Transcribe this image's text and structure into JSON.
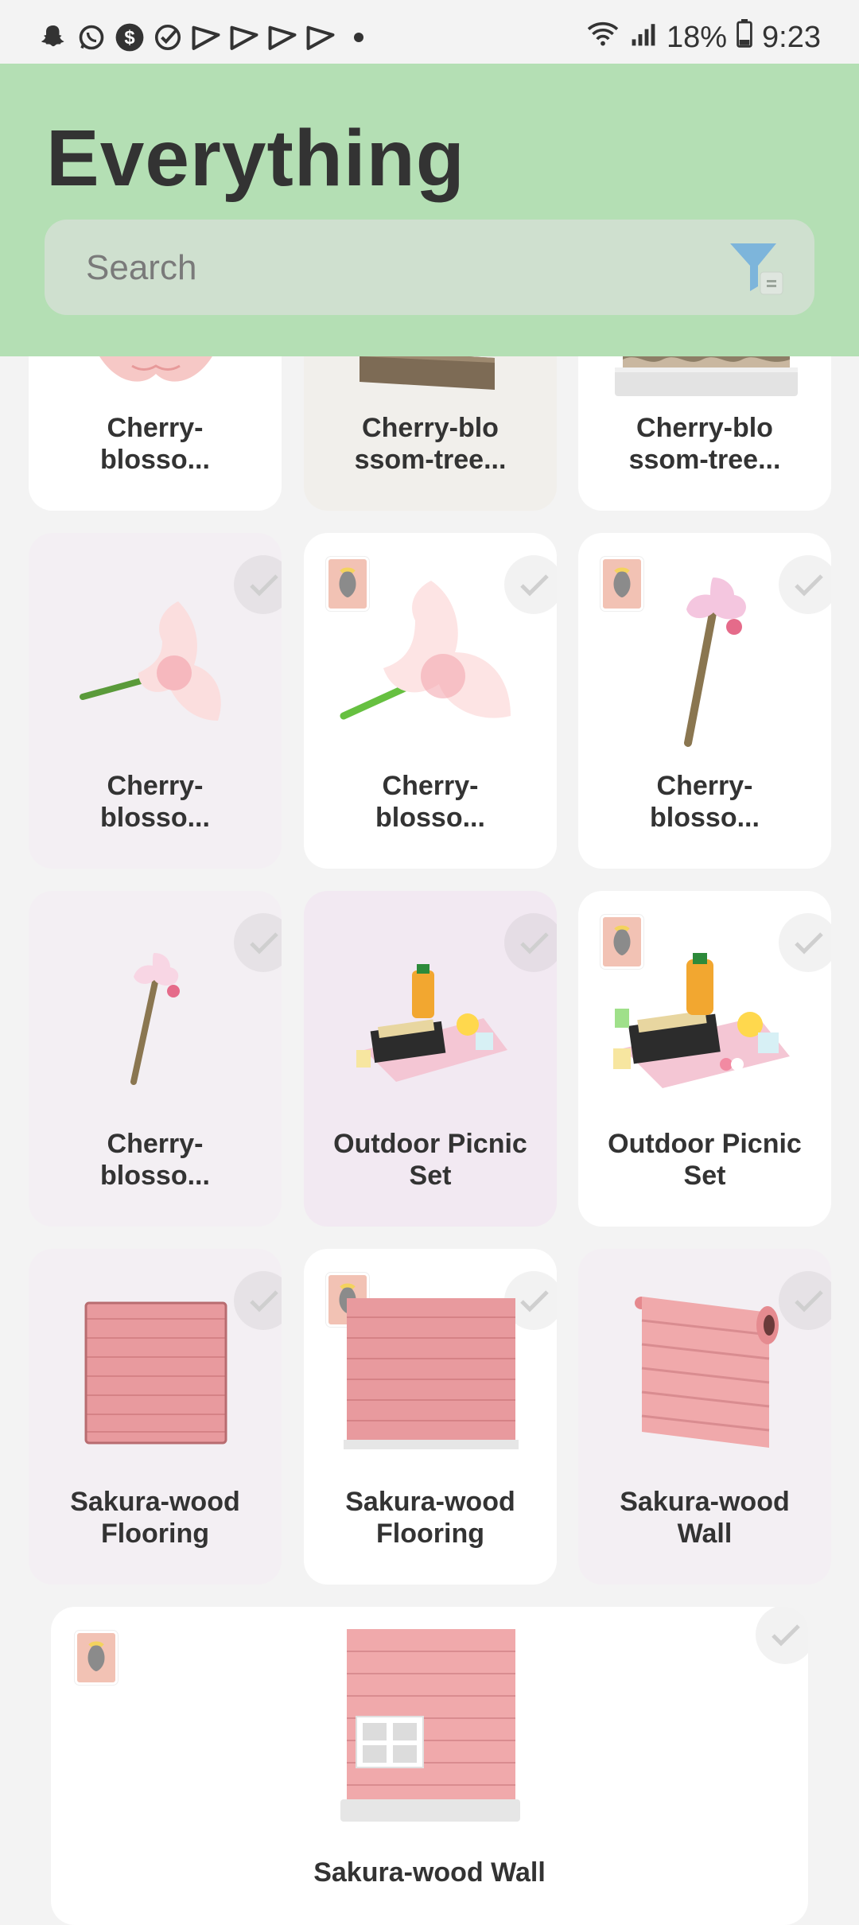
{
  "status": {
    "battery": "18%",
    "time": "9:23"
  },
  "header": {
    "title": "Everything",
    "search_placeholder": "Search"
  },
  "items": [
    {
      "name": "Cherry-\nblosso...",
      "icon": "cherry-blossom-petal-icon",
      "collected": false
    },
    {
      "name": "Cherry-blo\nssom-tree...",
      "icon": "cherry-blossom-tree-wall-icon",
      "collected": false
    },
    {
      "name": "Cherry-blo\nssom-tree...",
      "icon": "cherry-blossom-tree-wall-icon",
      "collected": false
    },
    {
      "name": "Cherry-\nblosso...",
      "icon": "cherry-blossom-branch-icon",
      "collected": false
    },
    {
      "name": "Cherry-\nblosso...",
      "icon": "cherry-blossom-branch-icon",
      "collected": false
    },
    {
      "name": "Cherry-\nblosso...",
      "icon": "cherry-blossom-wand-icon",
      "collected": false
    },
    {
      "name": "Cherry-\nblosso...",
      "icon": "cherry-blossom-wand-icon",
      "collected": false
    },
    {
      "name": "Outdoor Picnic\nSet",
      "icon": "picnic-set-icon",
      "collected": false
    },
    {
      "name": "Outdoor Picnic\nSet",
      "icon": "picnic-set-icon",
      "collected": false
    },
    {
      "name": "Sakura-wood\nFlooring",
      "icon": "wood-flooring-icon",
      "collected": false
    },
    {
      "name": "Sakura-wood\nFlooring",
      "icon": "wood-flooring-icon",
      "collected": false
    },
    {
      "name": "Sakura-wood\nWall",
      "icon": "wood-wall-roll-icon",
      "collected": false
    },
    {
      "name": "Sakura-wood Wall",
      "icon": "wood-wall-window-icon",
      "collected": false
    }
  ],
  "colors": {
    "header": "#b4dfb4",
    "card_white": "#ffffff",
    "card_tint": "#f3eff3",
    "card_purple": "#f2e9f2"
  }
}
